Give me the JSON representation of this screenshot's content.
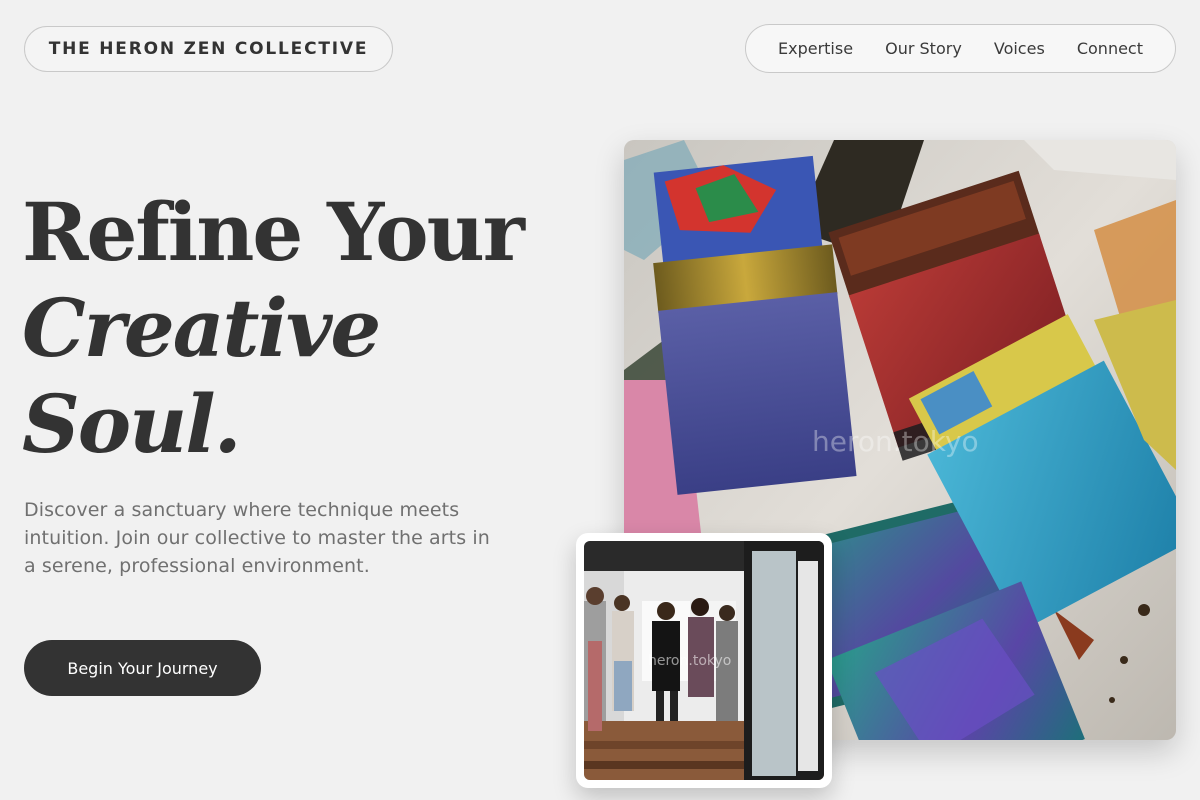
{
  "header": {
    "brand": "THE HERON ZEN COLLECTIVE",
    "nav": [
      "Expertise",
      "Our Story",
      "Voices",
      "Connect"
    ]
  },
  "hero": {
    "headline_line1": "Refine Your",
    "headline_line2": "Creative",
    "headline_line3": "Soul.",
    "intro": "Discover a sanctuary where technique meets intuition. Join our collective to master the arts in a serene, professional environment.",
    "cta_label": "Begin Your Journey"
  },
  "images": {
    "main_watermark": "heron.tokyo",
    "inset_watermark": "heron.tokyo"
  }
}
